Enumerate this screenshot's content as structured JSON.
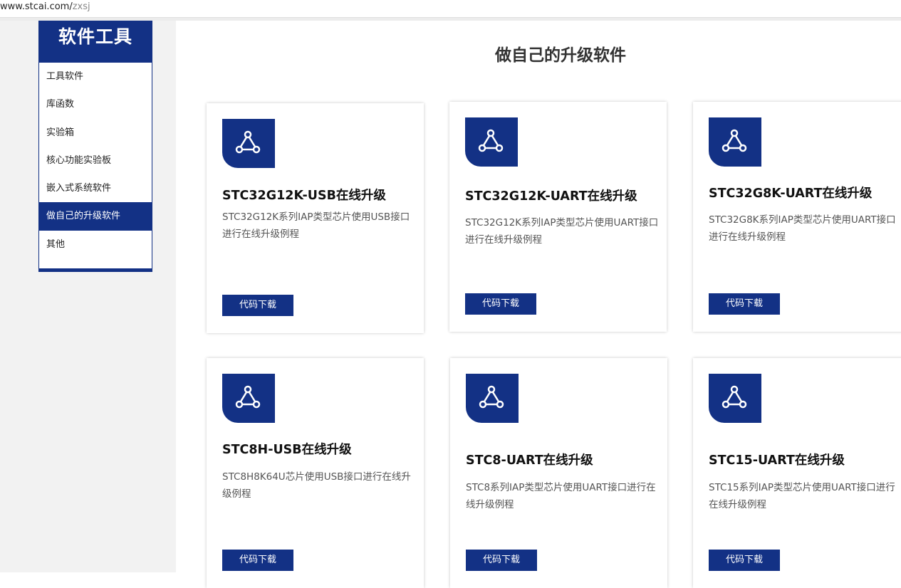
{
  "browser": {
    "url_host": "www.stcai.com/",
    "url_path": "zxsj"
  },
  "sidebar": {
    "title": "软件工具",
    "items": [
      {
        "label": "工具软件",
        "active": false
      },
      {
        "label": "库函数",
        "active": false
      },
      {
        "label": "实验箱",
        "active": false
      },
      {
        "label": "核心功能实验板",
        "active": false
      },
      {
        "label": "嵌入式系统软件",
        "active": false
      },
      {
        "label": "做自己的升级软件",
        "active": true
      },
      {
        "label": "其他",
        "active": false
      }
    ]
  },
  "main": {
    "title": "做自己的升级软件",
    "cards": [
      {
        "title": "STC32G12K-USB在线升级",
        "desc": "STC32G12K系列IAP类型芯片使用USB接口进行在线升级例程",
        "button": "代码下载",
        "icon": "share-nodes-icon"
      },
      {
        "title": "STC32G12K-UART在线升级",
        "desc": "STC32G12K系列IAP类型芯片使用UART接口进行在线升级例程",
        "button": "代码下载",
        "icon": "share-nodes-icon"
      },
      {
        "title": "STC32G8K-UART在线升级",
        "desc": "STC32G8K系列IAP类型芯片使用UART接口进行在线升级例程",
        "button": "代码下载",
        "icon": "share-nodes-icon"
      },
      {
        "title": "STC8H-USB在线升级",
        "desc": "STC8H8K64U芯片使用USB接口进行在线升级例程",
        "button": "代码下载",
        "icon": "share-nodes-icon"
      },
      {
        "title": "STC8-UART在线升级",
        "desc": "STC8系列IAP类型芯片使用UART接口进行在线升级例程",
        "button": "代码下载",
        "icon": "share-nodes-icon"
      },
      {
        "title": "STC15-UART在线升级",
        "desc": "STC15系列IAP类型芯片使用UART接口进行在线升级例程",
        "button": "代码下载",
        "icon": "share-nodes-icon"
      }
    ]
  },
  "colors": {
    "brand": "#133185",
    "text": "#222222",
    "muted": "#555555",
    "sidebar_bg": "#f2f2f2"
  }
}
